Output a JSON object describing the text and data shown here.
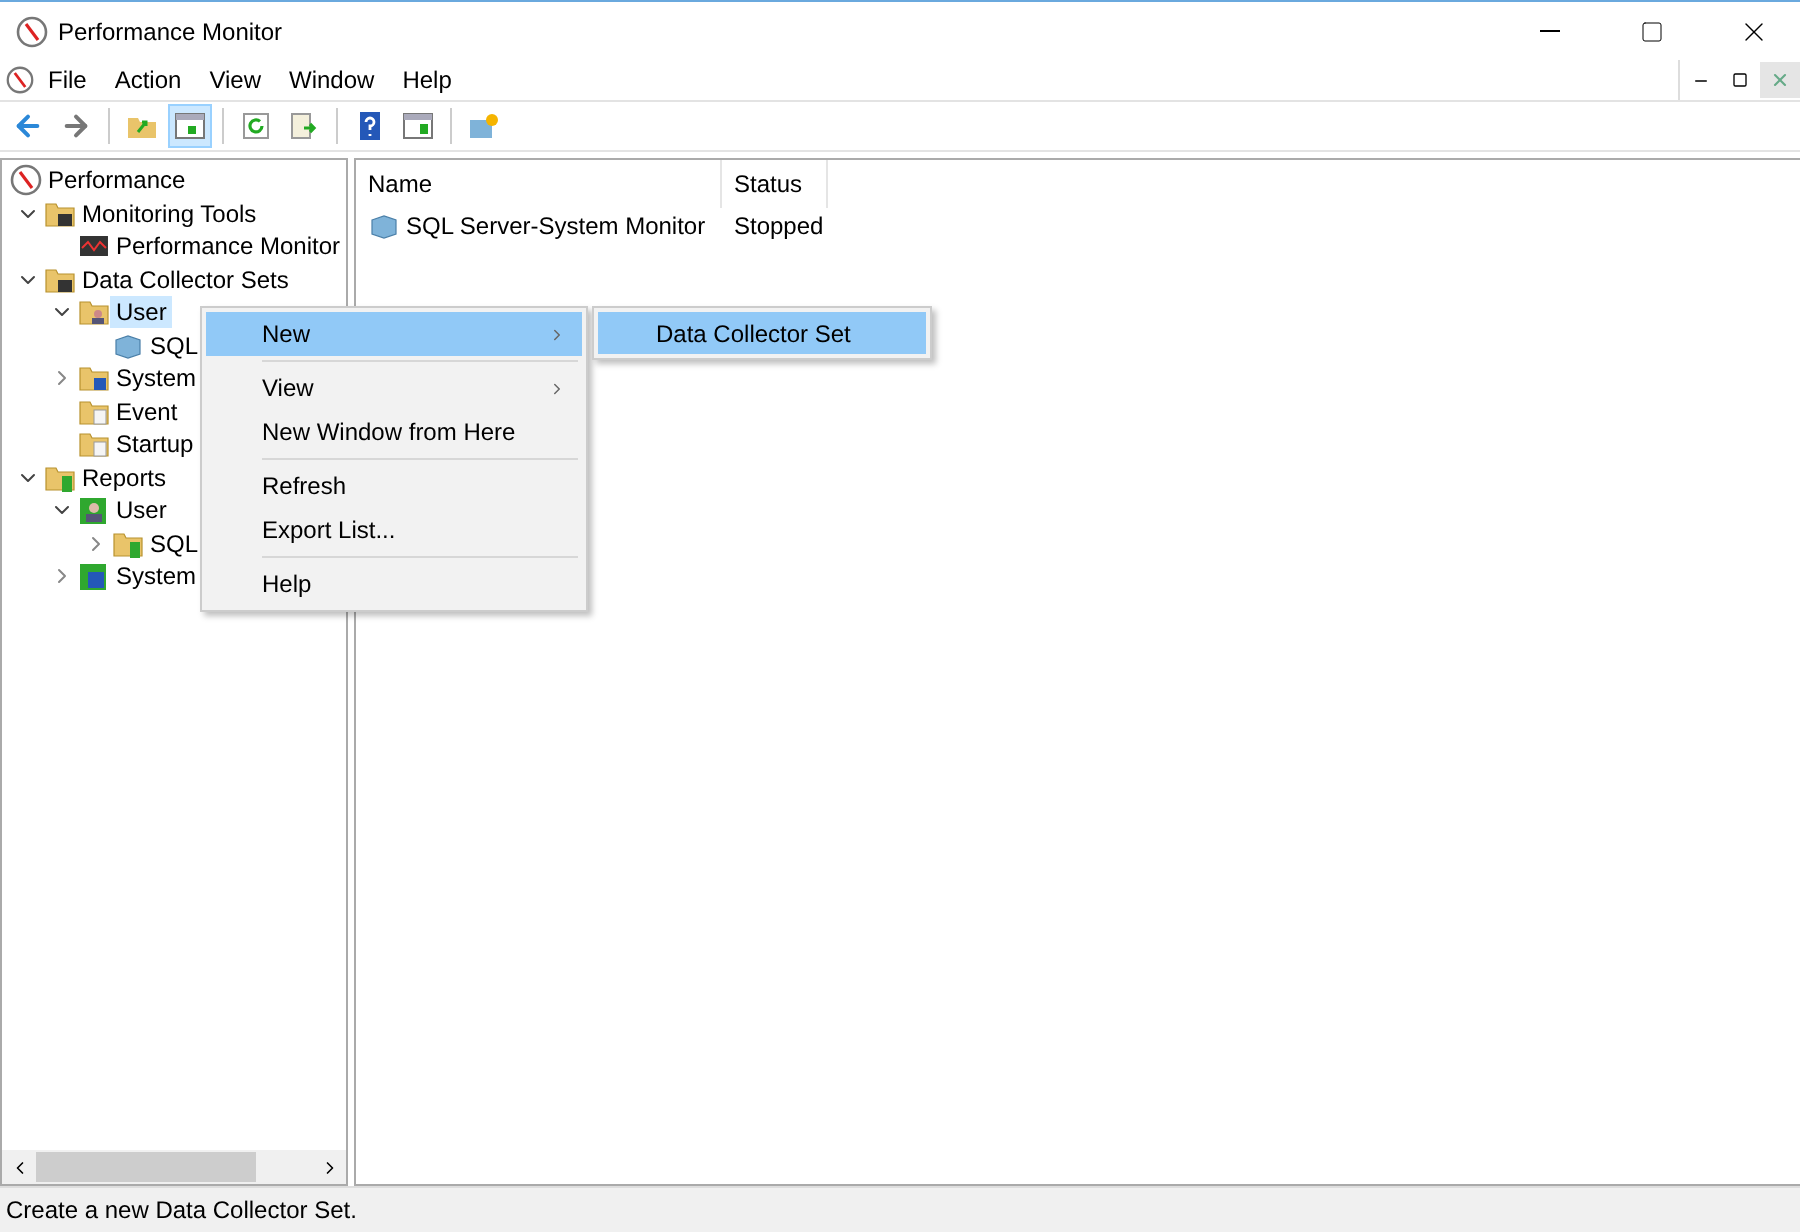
{
  "window": {
    "title": "Performance Monitor"
  },
  "menu_bar": [
    "File",
    "Action",
    "View",
    "Window",
    "Help"
  ],
  "toolbar": [
    {
      "kind": "back",
      "pressed": false
    },
    {
      "kind": "forward",
      "pressed": false
    },
    {
      "kind": "sep"
    },
    {
      "kind": "up",
      "pressed": false
    },
    {
      "kind": "tree",
      "pressed": true
    },
    {
      "kind": "sep"
    },
    {
      "kind": "refresh",
      "pressed": false
    },
    {
      "kind": "export",
      "pressed": false
    },
    {
      "kind": "sep"
    },
    {
      "kind": "help",
      "pressed": false
    },
    {
      "kind": "pane",
      "pressed": false
    },
    {
      "kind": "sep"
    },
    {
      "kind": "new",
      "pressed": false
    }
  ],
  "tree": [
    {
      "label": "Performance",
      "kind": "root",
      "selected": false,
      "children": [
        {
          "label": "Monitoring Tools",
          "kind": "folder",
          "expanded": true,
          "selected": false,
          "children": [
            {
              "label": "Performance Monitor",
              "kind": "monitor",
              "selected": false
            }
          ]
        },
        {
          "label": "Data Collector Sets",
          "kind": "folder",
          "expanded": true,
          "selected": false,
          "children": [
            {
              "label": "User",
              "kind": "folder-user",
              "expanded": true,
              "selected": true,
              "children": [
                {
                  "label": "SQL",
                  "kind": "database",
                  "selected": false
                }
              ]
            },
            {
              "label": "System",
              "kind": "folder-system",
              "expanded": false,
              "selected": false
            },
            {
              "label": "Event",
              "kind": "folder-doc",
              "selected": false
            },
            {
              "label": "Startup",
              "kind": "folder-doc",
              "selected": false
            }
          ]
        },
        {
          "label": "Reports",
          "kind": "folder-report",
          "expanded": true,
          "selected": false,
          "children": [
            {
              "label": "User",
              "kind": "report-user",
              "expanded": true,
              "selected": false,
              "children": [
                {
                  "label": "SQL",
                  "kind": "folder-report",
                  "expanded": false,
                  "selected": false
                }
              ]
            },
            {
              "label": "System",
              "kind": "report-system",
              "expanded": false,
              "selected": false
            }
          ]
        }
      ]
    }
  ],
  "table": {
    "columns": [
      "Name",
      "Status"
    ],
    "rows": [
      {
        "name": "SQL Server-System Monitor",
        "status": "Stopped"
      }
    ]
  },
  "context_menu": {
    "groups": [
      [
        {
          "label": "New",
          "submenu": true,
          "selected": true
        }
      ],
      [
        {
          "label": "View",
          "submenu": true,
          "selected": false
        },
        {
          "label": "New Window from Here",
          "submenu": false,
          "selected": false
        }
      ],
      [
        {
          "label": "Refresh",
          "submenu": false,
          "selected": false
        },
        {
          "label": "Export List...",
          "submenu": false,
          "selected": false
        }
      ],
      [
        {
          "label": "Help",
          "submenu": false,
          "selected": false
        }
      ]
    ]
  },
  "submenu": [
    {
      "label": "Data Collector Set",
      "selected": true
    }
  ],
  "status_bar": "Create a new Data Collector Set."
}
